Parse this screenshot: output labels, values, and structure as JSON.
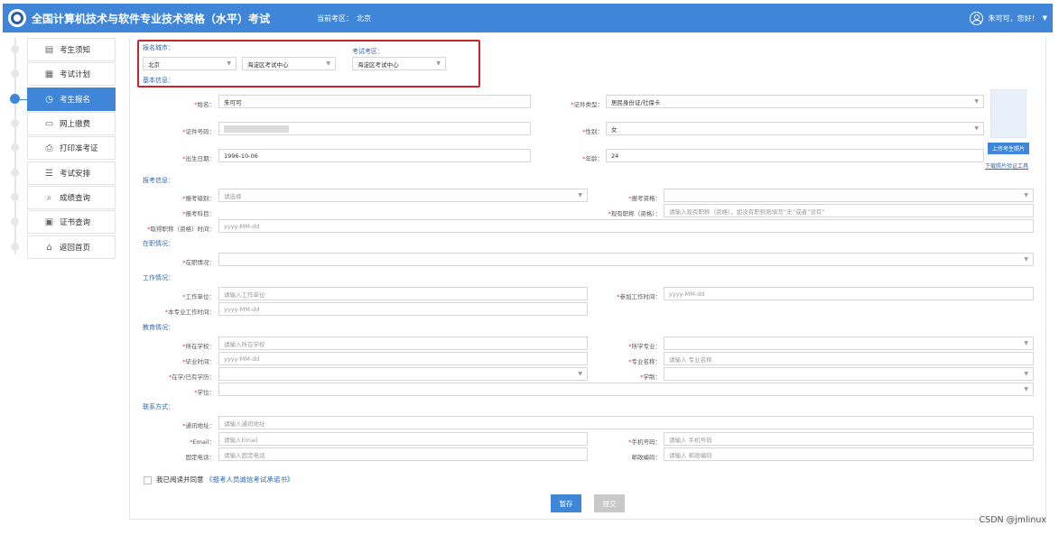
{
  "header": {
    "title": "全国计算机技术与软件专业技术资格（水平）考试",
    "region_label": "当前考区：",
    "region_value": "北京",
    "user_greeting": "朱可可，您好！",
    "user_caret": "▼"
  },
  "sidebar": {
    "items": [
      {
        "label": "考生须知",
        "icon": "notice-icon"
      },
      {
        "label": "考试计划",
        "icon": "calendar-icon"
      },
      {
        "label": "考生报名",
        "icon": "clock-icon"
      },
      {
        "label": "网上缴费",
        "icon": "payment-icon"
      },
      {
        "label": "打印准考证",
        "icon": "printer-icon"
      },
      {
        "label": "考试安排",
        "icon": "schedule-icon"
      },
      {
        "label": "成绩查询",
        "icon": "search-icon"
      },
      {
        "label": "证书查询",
        "icon": "certificate-icon"
      },
      {
        "label": "返回首页",
        "icon": "home-icon"
      }
    ],
    "active_index": 2
  },
  "location": {
    "city_label": "报名城市：",
    "city_value": "北京",
    "center_value": "海淀区考试中心",
    "exam_center_label": "考试考区：",
    "exam_center_value": "海淀区考试中心"
  },
  "basic": {
    "section": "基本信息：",
    "name_label": "姓名：",
    "name_value": "朱可可",
    "id_type_label": "证件类型：",
    "id_type_value": "居民身份证/社保卡",
    "id_no_label": "证件号码：",
    "gender_label": "性别：",
    "gender_value": "女",
    "birth_label": "出生日期：",
    "birth_value": "1996-10-06",
    "age_label": "年龄：",
    "age_value": "24",
    "upload_photo": "上传考生照片",
    "download_tool": "下载照片验证工具"
  },
  "exam": {
    "section": "报考信息：",
    "level_label": "报考级别：",
    "level_placeholder": "请选择",
    "qual_label": "报考资格：",
    "subject_label": "报考科目：",
    "title_label": "现有职称（资格）：",
    "title_placeholder": "请输入现有职称（资格），如没有职称则填写“无”或者“没有”",
    "title_time_label": "取得职称（资格）时间：",
    "date_placeholder": "yyyy-MM-dd"
  },
  "employment": {
    "section": "在职情况：",
    "status_label": "在职情况："
  },
  "work": {
    "section": "工作情况：",
    "unit_label": "工作单位：",
    "unit_placeholder": "请输入工作单位",
    "start_label": "参加工作时间：",
    "major_time_label": "本专业工作时间："
  },
  "education": {
    "section": "教育情况：",
    "school_label": "所在学校：",
    "school_placeholder": "请输入所在学校",
    "major_label": "所学专业：",
    "grad_label": "毕业时间：",
    "major_name_label": "专业名称：",
    "major_name_placeholder": "请输入 专业名称",
    "degree_label": "在学/已有学历：",
    "duration_label": "学制：",
    "diploma_label": "学位："
  },
  "contact": {
    "section": "联系方式：",
    "address_label": "通讯地址：",
    "address_placeholder": "请输入通讯地址",
    "email_label": "Email：",
    "email_placeholder": "请输入Email",
    "mobile_label": "手机号码：",
    "mobile_placeholder": "请输入 手机号码",
    "phone_label": "固定电话：",
    "phone_placeholder": "请输入固定电话",
    "zip_label": "邮政编码：",
    "zip_placeholder": "请输入 邮政编码"
  },
  "agreement": {
    "text": "我已阅读并同意",
    "link": "《报考人员诚信考试承诺书》"
  },
  "buttons": {
    "save": "暂存",
    "submit": "提交"
  },
  "watermark": "CSDN @jmlinux",
  "colors": {
    "primary": "#3f86d8",
    "highlight": "#c9252c",
    "required": "#e53935"
  }
}
